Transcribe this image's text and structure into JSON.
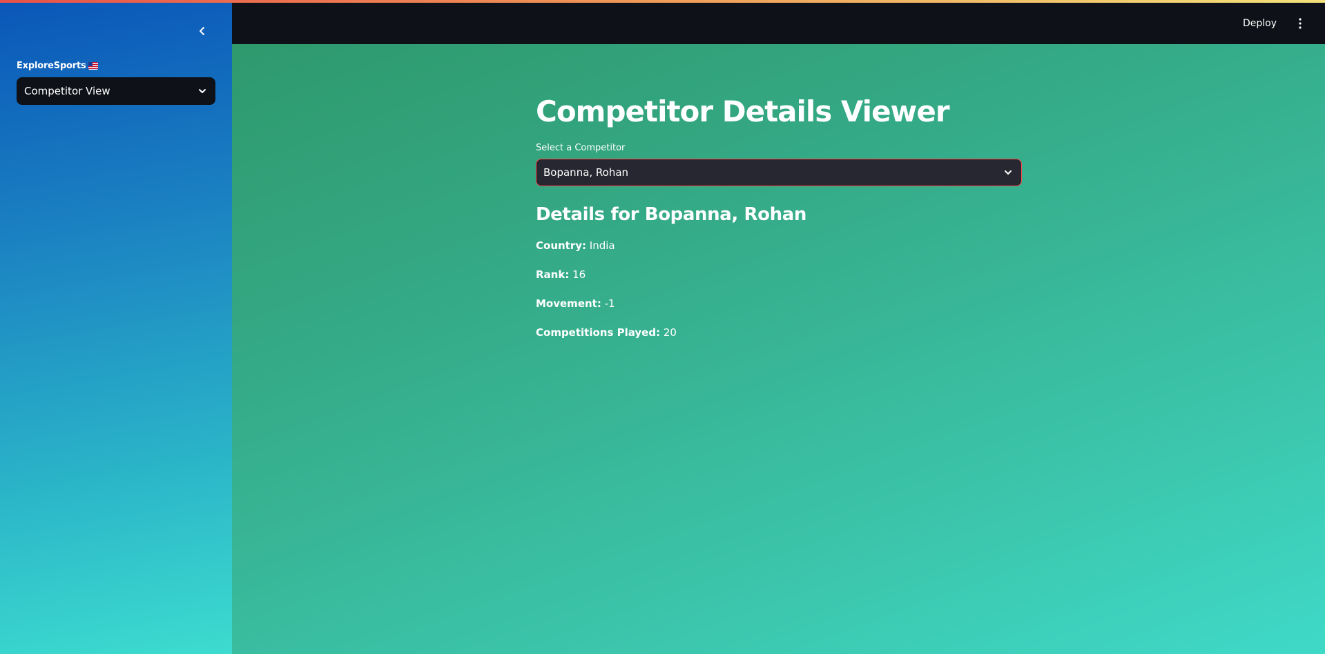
{
  "sidebar": {
    "collapse_icon": "chevron-left-icon",
    "label": "ExploreSports",
    "label_icon": "us-flag-icon",
    "select": {
      "value": "Competitor View",
      "icon": "chevron-down-icon"
    }
  },
  "header": {
    "deploy_label": "Deploy",
    "menu_icon": "vertical-dots-icon"
  },
  "main": {
    "title": "Competitor Details Viewer",
    "select_label": "Select a Competitor",
    "select_value": "Bopanna, Rohan",
    "details_heading": "Details for Bopanna, Rohan",
    "details": [
      {
        "label": "Country:",
        "value": "India"
      },
      {
        "label": "Rank:",
        "value": "16"
      },
      {
        "label": "Movement:",
        "value": "-1"
      },
      {
        "label": "Competitions Played:",
        "value": "20"
      }
    ]
  },
  "colors": {
    "header_bg": "#0e1117",
    "select_border": "#ff4b4b",
    "select_bg": "#262730"
  }
}
